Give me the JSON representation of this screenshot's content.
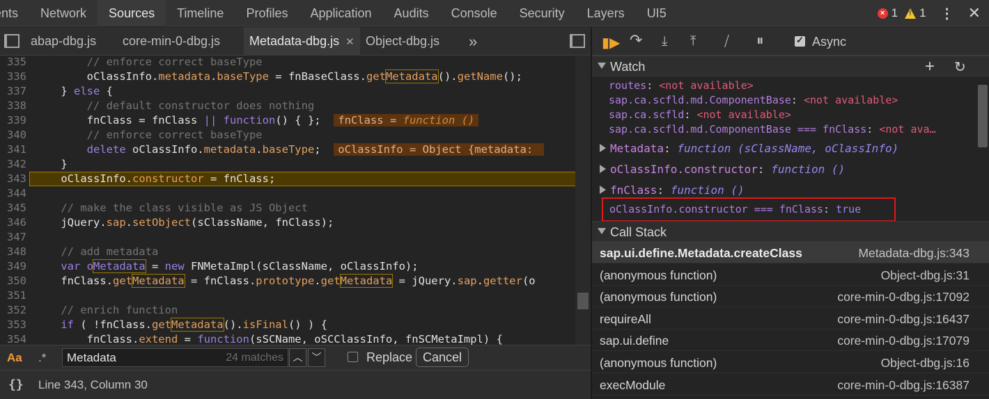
{
  "panel_tabs": [
    "ents",
    "Network",
    "Sources",
    "Timeline",
    "Profiles",
    "Application",
    "Audits",
    "Console",
    "Security",
    "Layers",
    "UI5"
  ],
  "active_panel_tab": "Sources",
  "error_count": "1",
  "warning_count": "1",
  "file_tabs": [
    "abap-dbg.js",
    "core-min-0-dbg.js",
    "Metadata-dbg.js",
    "Object-dbg.js"
  ],
  "active_file_tab": "Metadata-dbg.js",
  "more_tabs_glyph": "»",
  "code_lines": [
    {
      "num": "335",
      "segments": [
        {
          "t": "        ",
          "c": "v"
        },
        {
          "t": "// enforce correct baseType",
          "c": "com"
        }
      ]
    },
    {
      "num": "336",
      "segments": [
        {
          "t": "        oClassInfo.",
          "c": "v"
        },
        {
          "t": "metadata",
          "c": "p"
        },
        {
          "t": ".",
          "c": "v"
        },
        {
          "t": "baseType",
          "c": "p"
        },
        {
          "t": " = fnBaseClass.",
          "c": "v"
        },
        {
          "t": "get",
          "c": "p"
        },
        {
          "t": "Metadata",
          "c": "pm"
        },
        {
          "t": "().",
          "c": "v"
        },
        {
          "t": "getName",
          "c": "p"
        },
        {
          "t": "();",
          "c": "v"
        }
      ]
    },
    {
      "num": "337",
      "segments": [
        {
          "t": "    } ",
          "c": "v"
        },
        {
          "t": "else",
          "c": "k"
        },
        {
          "t": " {",
          "c": "v"
        }
      ]
    },
    {
      "num": "338",
      "segments": [
        {
          "t": "        ",
          "c": "v"
        },
        {
          "t": "// default constructor does nothing",
          "c": "com"
        }
      ]
    },
    {
      "num": "339",
      "segments": [
        {
          "t": "        fnClass = fnClass ",
          "c": "v"
        },
        {
          "t": "||",
          "c": "k"
        },
        {
          "t": " ",
          "c": "v"
        },
        {
          "t": "function",
          "c": "k"
        },
        {
          "t": "() { };  ",
          "c": "v"
        },
        {
          "t": "fnClass = |function ()",
          "c": "iv"
        }
      ]
    },
    {
      "num": "340",
      "segments": [
        {
          "t": "        ",
          "c": "v"
        },
        {
          "t": "// enforce correct baseType",
          "c": "com"
        }
      ]
    },
    {
      "num": "341",
      "segments": [
        {
          "t": "        ",
          "c": "v"
        },
        {
          "t": "delete",
          "c": "k"
        },
        {
          "t": " oClassInfo.",
          "c": "v"
        },
        {
          "t": "metadata",
          "c": "p"
        },
        {
          "t": ".",
          "c": "v"
        },
        {
          "t": "baseType",
          "c": "p"
        },
        {
          "t": ";  ",
          "c": "v"
        },
        {
          "t": "oClassInfo = Object {metadata: ",
          "c": "iv"
        }
      ]
    },
    {
      "num": "342",
      "segments": [
        {
          "t": "    }",
          "c": "v"
        }
      ]
    },
    {
      "num": "343",
      "segments": [
        {
          "t": "    oClassInfo.",
          "c": "v"
        },
        {
          "t": "constructor",
          "c": "p"
        },
        {
          "t": " = fnClass;",
          "c": "v"
        }
      ],
      "exec": true
    },
    {
      "num": "344",
      "segments": []
    },
    {
      "num": "345",
      "segments": [
        {
          "t": "    ",
          "c": "v"
        },
        {
          "t": "// make the class visible as JS Object",
          "c": "com"
        }
      ]
    },
    {
      "num": "346",
      "segments": [
        {
          "t": "    jQuery.",
          "c": "v"
        },
        {
          "t": "sap",
          "c": "p"
        },
        {
          "t": ".",
          "c": "v"
        },
        {
          "t": "setObject",
          "c": "p"
        },
        {
          "t": "(sClassName, fnClass);",
          "c": "v"
        }
      ]
    },
    {
      "num": "347",
      "segments": []
    },
    {
      "num": "348",
      "segments": [
        {
          "t": "    ",
          "c": "v"
        },
        {
          "t": "// add metadata",
          "c": "com"
        }
      ]
    },
    {
      "num": "349",
      "segments": [
        {
          "t": "    ",
          "c": "v"
        },
        {
          "t": "var",
          "c": "k"
        },
        {
          "t": " o",
          "c": "b"
        },
        {
          "t": "Metadata",
          "c": "bm"
        },
        {
          "t": " = ",
          "c": "v"
        },
        {
          "t": "new",
          "c": "k"
        },
        {
          "t": " FNMetaImpl(sClassName, oClassInfo);",
          "c": "v"
        }
      ]
    },
    {
      "num": "350",
      "segments": [
        {
          "t": "    fnClass.",
          "c": "v"
        },
        {
          "t": "get",
          "c": "p"
        },
        {
          "t": "Metadata",
          "c": "pm"
        },
        {
          "t": " = fnClass.",
          "c": "v"
        },
        {
          "t": "prototype",
          "c": "p"
        },
        {
          "t": ".",
          "c": "v"
        },
        {
          "t": "get",
          "c": "p"
        },
        {
          "t": "Metadata",
          "c": "pm"
        },
        {
          "t": " = jQuery.",
          "c": "v"
        },
        {
          "t": "sap",
          "c": "p"
        },
        {
          "t": ".",
          "c": "v"
        },
        {
          "t": "getter",
          "c": "p"
        },
        {
          "t": "(o",
          "c": "v"
        }
      ]
    },
    {
      "num": "351",
      "segments": []
    },
    {
      "num": "352",
      "segments": [
        {
          "t": "    ",
          "c": "v"
        },
        {
          "t": "// enrich function",
          "c": "com"
        }
      ]
    },
    {
      "num": "353",
      "segments": [
        {
          "t": "    ",
          "c": "v"
        },
        {
          "t": "if",
          "c": "k"
        },
        {
          "t": " ( !fnClass.",
          "c": "v"
        },
        {
          "t": "get",
          "c": "p"
        },
        {
          "t": "Metadata",
          "c": "pm"
        },
        {
          "t": "().",
          "c": "v"
        },
        {
          "t": "isFinal",
          "c": "p"
        },
        {
          "t": "() ) {",
          "c": "v"
        }
      ]
    },
    {
      "num": "354",
      "segments": [
        {
          "t": "        fnClass.",
          "c": "v"
        },
        {
          "t": "extend",
          "c": "p"
        },
        {
          "t": " = ",
          "c": "v"
        },
        {
          "t": "function",
          "c": "k"
        },
        {
          "t": "(sSCName, oSCClassInfo, fnSCMetaImpl) {",
          "c": "v"
        }
      ]
    }
  ],
  "search": {
    "case_label": "Aa",
    "regex_label": ".*",
    "value": "Metadata",
    "matches": "24 matches",
    "replace_label": "Replace",
    "cancel_label": "Cancel"
  },
  "status": {
    "braces": "{}",
    "position": "Line 343, Column 30"
  },
  "debugger": {
    "async_label": "Async",
    "watch_title": "Watch",
    "watch_plain": [
      {
        "name": "routes",
        "value": "<not available>"
      },
      {
        "name": "sap.ca.scfld.md.ComponentBase",
        "value": "<not available>"
      },
      {
        "name": "sap.ca.scfld",
        "value": "<not available>"
      },
      {
        "name": "sap.ca.scfld.md.ComponentBase === fnClass",
        "value": "<not ava…"
      }
    ],
    "watch_expandable": [
      {
        "name": "Metadata",
        "value": "function (sClassName, oClassInfo)"
      },
      {
        "name": "oClassInfo.constructor",
        "value": "function ()"
      },
      {
        "name": "fnClass",
        "value": "function ()"
      }
    ],
    "watch_highlight": {
      "name": "oClassInfo.constructor === fnClass",
      "value": "true"
    },
    "callstack_title": "Call Stack",
    "callstack": [
      {
        "fn": "sap.ui.define.Metadata.createClass",
        "loc": "Metadata-dbg.js:343"
      },
      {
        "fn": "(anonymous function)",
        "loc": "Object-dbg.js:31"
      },
      {
        "fn": "(anonymous function)",
        "loc": "core-min-0-dbg.js:17092"
      },
      {
        "fn": "requireAll",
        "loc": "core-min-0-dbg.js:16437"
      },
      {
        "fn": "sap.ui.define",
        "loc": "core-min-0-dbg.js:17079"
      },
      {
        "fn": "(anonymous function)",
        "loc": "Object-dbg.js:16"
      },
      {
        "fn": "execModule",
        "loc": "core-min-0-dbg.js:16387"
      }
    ]
  }
}
